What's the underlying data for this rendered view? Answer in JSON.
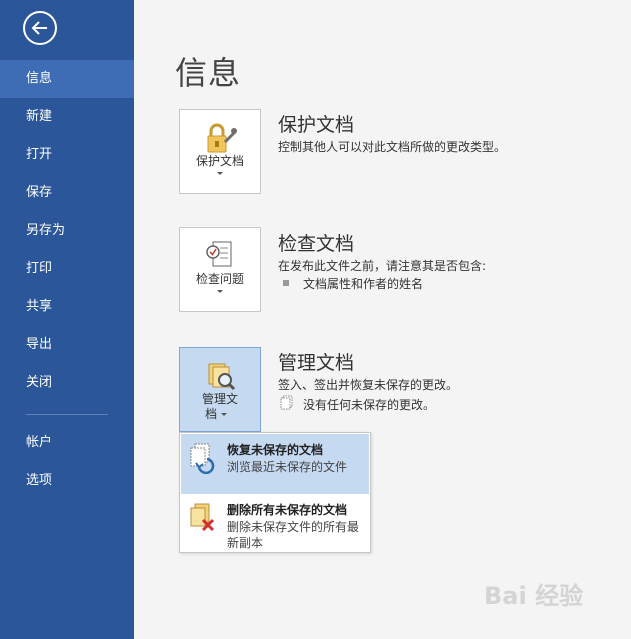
{
  "sidebar": {
    "items": [
      {
        "label": "信息",
        "active": true
      },
      {
        "label": "新建"
      },
      {
        "label": "打开"
      },
      {
        "label": "保存"
      },
      {
        "label": "另存为"
      },
      {
        "label": "打印"
      },
      {
        "label": "共享"
      },
      {
        "label": "导出"
      },
      {
        "label": "关闭"
      }
    ],
    "bottom_items": [
      {
        "label": "帐户"
      },
      {
        "label": "选项"
      }
    ]
  },
  "page": {
    "title": "信息"
  },
  "protect": {
    "button_label": "保护文档",
    "title": "保护文档",
    "desc": "控制其他人可以对此文档所做的更改类型。"
  },
  "inspect": {
    "button_label": "检查问题",
    "title": "检查文档",
    "desc": "在发布此文件之前，请注意其是否包含:",
    "bullet": "文档属性和作者的姓名"
  },
  "manage": {
    "button_label_line1": "管理文",
    "button_label_line2": "档",
    "title": "管理文档",
    "desc": "签入、签出并恢复未保存的更改。",
    "note": "没有任何未保存的更改。"
  },
  "dropdown": {
    "items": [
      {
        "title": "恢复未保存的文档",
        "sub": "浏览最近未保存的文件"
      },
      {
        "title": "删除所有未保存的文档",
        "sub": "删除未保存文件的所有最新副本"
      }
    ]
  },
  "watermark": "Bai 经验",
  "colors": {
    "sidebar": "#2b579a",
    "sidebar_active": "#3e6db5",
    "highlight": "#c5d9f1"
  }
}
